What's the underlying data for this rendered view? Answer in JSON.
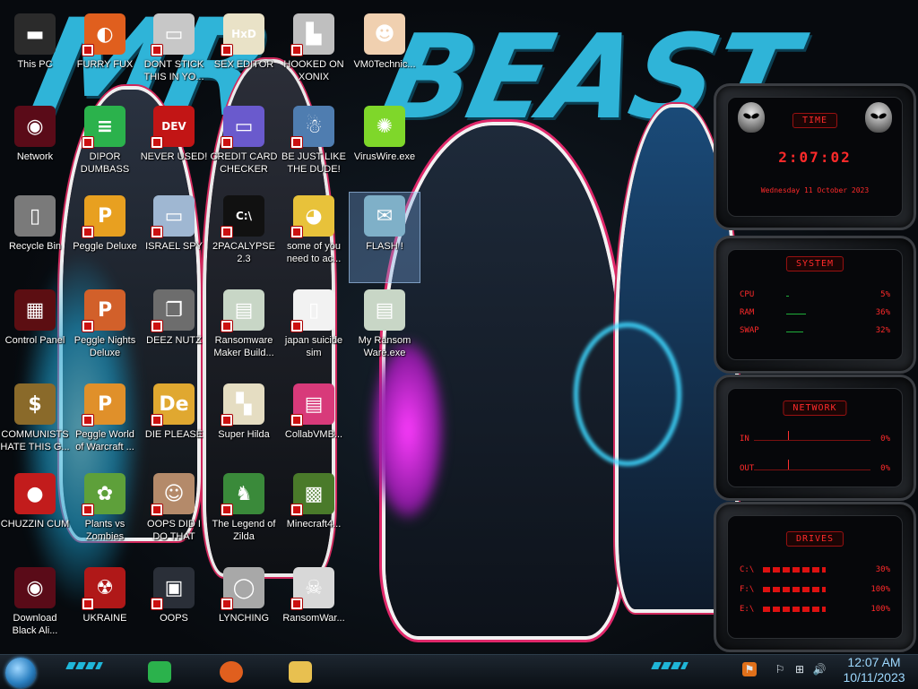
{
  "wallpaper": {
    "bg_text_1": "MR",
    "bg_text_2": "BEAST"
  },
  "desktop_icons": [
    {
      "label": "This PC",
      "icon": "computer-icon",
      "color": "#2b2b2b",
      "glyph": "▬",
      "shortcut": false
    },
    {
      "label": "Network",
      "icon": "alienware-orb-icon",
      "color": "#5a0b18",
      "glyph": "◉",
      "shortcut": false
    },
    {
      "label": "Recycle Bin",
      "icon": "recycle-bin-icon",
      "color": "#7a7a7a",
      "glyph": "▯",
      "shortcut": false
    },
    {
      "label": "Control Panel",
      "icon": "control-panel-icon",
      "color": "#5c0e12",
      "glyph": "▦",
      "shortcut": false
    },
    {
      "label": "COMMUNISTS HATE THIS G...",
      "icon": "money-bag-icon",
      "color": "#8a6a2a",
      "glyph": "$",
      "shortcut": false
    },
    {
      "label": "CHUZZIN CUM",
      "icon": "chuzzle-icon",
      "color": "#c21c1c",
      "glyph": "●",
      "shortcut": false
    },
    {
      "label": "Download Black Ali...",
      "icon": "alienware-orb-icon",
      "color": "#5a0b18",
      "glyph": "◉",
      "shortcut": false
    },
    {
      "label": "FURRY FUX",
      "icon": "firefox-icon",
      "color": "#e05f1e",
      "glyph": "◐",
      "shortcut": true
    },
    {
      "label": "DIPOR DUMBASS",
      "icon": "feedly-icon",
      "color": "#2bb24c",
      "glyph": "≡",
      "shortcut": true
    },
    {
      "label": "Peggle Deluxe",
      "icon": "peggle-icon",
      "color": "#e8a020",
      "glyph": "P",
      "shortcut": true
    },
    {
      "label": "Peggle Nights Deluxe",
      "icon": "peggle-icon",
      "color": "#d2602a",
      "glyph": "P",
      "shortcut": true
    },
    {
      "label": "Peggle World of Warcraft ...",
      "icon": "peggle-icon",
      "color": "#e0902a",
      "glyph": "P",
      "shortcut": true
    },
    {
      "label": "Plants vs Zombies",
      "icon": "pvz-icon",
      "color": "#5ea03a",
      "glyph": "✿",
      "shortcut": true
    },
    {
      "label": "UKRAINE",
      "icon": "radiation-icon",
      "color": "#b01818",
      "glyph": "☢",
      "shortcut": true
    },
    {
      "label": "DONT STICK THIS IN YO...",
      "icon": "usb-icon",
      "color": "#c7c7c7",
      "glyph": "▭",
      "shortcut": true
    },
    {
      "label": "NEVER USED!",
      "icon": "dev-cpp-icon",
      "color": "#c21515",
      "glyph": "DEV",
      "shortcut": true
    },
    {
      "label": "ISRAEL SPY",
      "icon": "spy-app-icon",
      "color": "#9fb7d2",
      "glyph": "▭",
      "shortcut": true
    },
    {
      "label": "DEEZ NUTZ",
      "icon": "windows-stack-icon",
      "color": "#6d6d6d",
      "glyph": "❐",
      "shortcut": true
    },
    {
      "label": "DIE PLEASE",
      "icon": "adobe-de-icon",
      "color": "#e0a830",
      "glyph": "De",
      "shortcut": true
    },
    {
      "label": "OOPS DID I DO THAT",
      "icon": "portrait-icon",
      "color": "#b48a6a",
      "glyph": "☺",
      "shortcut": true
    },
    {
      "label": "OOPS",
      "icon": "computer-mouse-icon",
      "color": "#2a2f38",
      "glyph": "▣",
      "shortcut": true
    },
    {
      "label": "SEX EDITOR",
      "icon": "hex-editor-icon",
      "color": "#e9e2c7",
      "glyph": "HxD",
      "shortcut": true
    },
    {
      "label": "CREDIT CARD CHECKER",
      "icon": "credit-card-icon",
      "color": "#6a5acd",
      "glyph": "▭",
      "shortcut": true
    },
    {
      "label": "2PACALYPSE 2.3",
      "icon": "terminal-icon",
      "color": "#111111",
      "glyph": "C:\\",
      "shortcut": true
    },
    {
      "label": "Ransomware Maker Build...",
      "icon": "window-app-icon",
      "color": "#c8d6c6",
      "glyph": "▤",
      "shortcut": true
    },
    {
      "label": "Super Hilda",
      "icon": "pixel-art-icon",
      "color": "#e5ddc2",
      "glyph": "▚",
      "shortcut": true
    },
    {
      "label": "The Legend of Zilda",
      "icon": "zelda-icon",
      "color": "#3a8a3a",
      "glyph": "♞",
      "shortcut": true
    },
    {
      "label": "LYNCHING",
      "icon": "noose-icon",
      "color": "#a8a8a8",
      "glyph": "◯",
      "shortcut": true
    },
    {
      "label": "HOOKED ON XONIX",
      "icon": "xonix-icon",
      "color": "#bfbfbf",
      "glyph": "▙",
      "shortcut": true
    },
    {
      "label": "BE JUST LIKE THE DUDE!",
      "icon": "santa-icon",
      "color": "#4f7db0",
      "glyph": "☃",
      "shortcut": true
    },
    {
      "label": "some of you need to ac...",
      "icon": "beaver-icon",
      "color": "#e8c23a",
      "glyph": "◕",
      "shortcut": true
    },
    {
      "label": "japan suicide sim",
      "icon": "document-icon",
      "color": "#f2f2f2",
      "glyph": "▯",
      "shortcut": true
    },
    {
      "label": "CollabVMB...",
      "icon": "collabvm-icon",
      "color": "#d83a7a",
      "glyph": "▤",
      "shortcut": true
    },
    {
      "label": "Minecraft4...",
      "icon": "minecraft-icon",
      "color": "#4a7a2a",
      "glyph": "▩",
      "shortcut": true
    },
    {
      "label": "RansomWar...",
      "icon": "skull-icon",
      "color": "#d8d8d8",
      "glyph": "☠",
      "shortcut": true
    },
    {
      "label": "VM0Technic...",
      "icon": "technician-icon",
      "color": "#f0d0b0",
      "glyph": "☻",
      "shortcut": false
    },
    {
      "label": "VirusWire.exe",
      "icon": "lime-icon",
      "color": "#7fd72a",
      "glyph": "✺",
      "shortcut": false
    },
    {
      "label": "FLASH !",
      "icon": "flash-icon",
      "color": "#7fb0c8",
      "glyph": "✉",
      "shortcut": false,
      "selected": true
    },
    {
      "label": "My Ransom Ware.exe",
      "icon": "window-app-icon",
      "color": "#c8d6c6",
      "glyph": "▤",
      "shortcut": false
    }
  ],
  "gadgets": {
    "time": {
      "title": "TIME",
      "clock": "2:07:02",
      "date": "Wednesday 11 October 2023"
    },
    "system": {
      "title": "SYSTEM",
      "rows": [
        {
          "label": "CPU",
          "value": "5%",
          "level": 0.05
        },
        {
          "label": "RAM",
          "value": "36%",
          "level": 0.36
        },
        {
          "label": "SWAP",
          "value": "32%",
          "level": 0.32
        }
      ]
    },
    "network": {
      "title": "NETWORK",
      "rows": [
        {
          "label": "IN",
          "value": "0%"
        },
        {
          "label": "OUT",
          "value": "0%"
        }
      ]
    },
    "drives": {
      "title": "DRIVES",
      "rows": [
        {
          "label": "C:\\",
          "value": "30%"
        },
        {
          "label": "F:\\",
          "value": "100%"
        },
        {
          "label": "E:\\",
          "value": "100%"
        }
      ]
    }
  },
  "taskbar": {
    "pinned": [
      {
        "name": "feedly-icon",
        "color": "#2bb24c"
      },
      {
        "name": "firefox-icon",
        "color": "#e05f1e"
      },
      {
        "name": "file-explorer-icon",
        "color": "#e8c050"
      }
    ],
    "tray": [
      {
        "name": "flag-app-icon",
        "glyph": "⚑"
      },
      {
        "name": "action-center-icon",
        "glyph": "⚐"
      },
      {
        "name": "network-status-icon",
        "glyph": "⊞"
      },
      {
        "name": "volume-icon",
        "glyph": "🔊"
      }
    ],
    "clock_time": "12:07 AM",
    "clock_date": "10/11/2023"
  }
}
